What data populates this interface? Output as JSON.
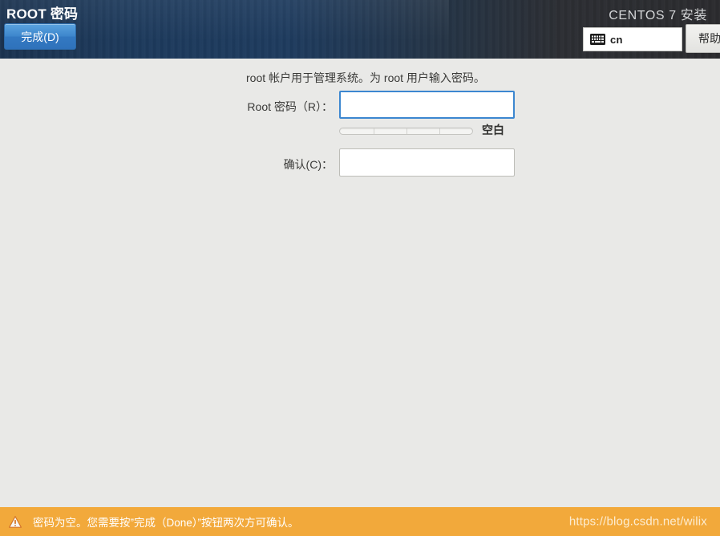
{
  "header": {
    "page_title": "ROOT 密码",
    "product_title": "CENTOS 7 安装",
    "done_button": "完成(D)",
    "help_button": "帮助",
    "keyboard_layout": "cn",
    "keyboard_icon": "keyboard-icon"
  },
  "main": {
    "description": "root 帐户用于管理系统。为 root 用户输入密码。",
    "fields": {
      "password": {
        "label": "Root 密码（R）：",
        "value": "",
        "placeholder": ""
      },
      "confirm": {
        "label": "确认(C)：",
        "value": "",
        "placeholder": ""
      }
    },
    "strength": {
      "label": "空白",
      "percent": 0,
      "segments": 4
    }
  },
  "status": {
    "warning_icon": "warning-triangle-icon",
    "warning_text": "密码为空。您需要按”完成（Done）”按钮两次方可确认。",
    "watermark": "https://blog.csdn.net/wilix"
  },
  "colors": {
    "accent_blue": "#3c87d0",
    "header_blue": "#1e3b5e",
    "header_dark": "#2b2b2e",
    "warning_orange": "#f2a93b",
    "body_bg": "#e9e9e7"
  }
}
